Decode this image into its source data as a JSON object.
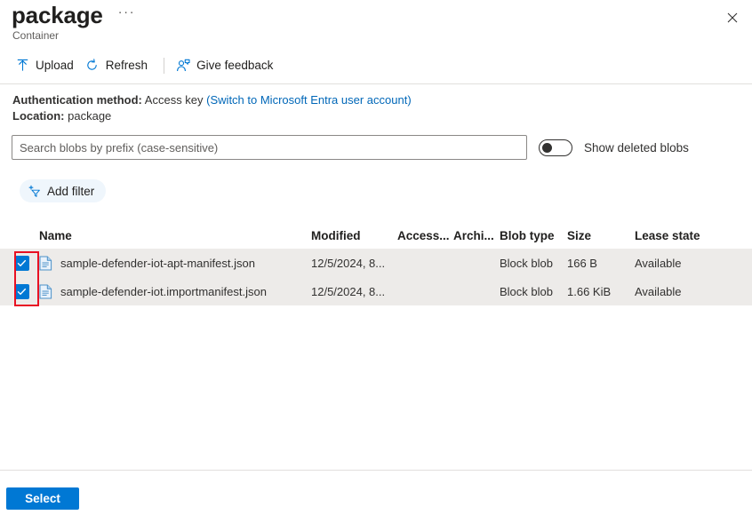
{
  "header": {
    "title": "package",
    "subtitle": "Container",
    "ellipsis": "···",
    "close_icon": "close-icon"
  },
  "commandbar": {
    "items": [
      {
        "label": "Upload",
        "icon": "upload-icon"
      },
      {
        "label": "Refresh",
        "icon": "refresh-icon"
      },
      {
        "label": "Give feedback",
        "icon": "feedback-person-icon"
      }
    ]
  },
  "auth": {
    "method_label": "Authentication method:",
    "method_value": "Access key",
    "switch_link": "(Switch to Microsoft Entra user account)",
    "location_label": "Location:",
    "location_value": "package"
  },
  "search": {
    "placeholder": "Search blobs by prefix (case-sensitive)",
    "value": ""
  },
  "toggle": {
    "label": "Show deleted blobs",
    "checked": false
  },
  "filter": {
    "add_label": "Add filter",
    "icon": "add-filter-funnel-icon"
  },
  "table": {
    "columns": [
      "Name",
      "Modified",
      "Access...",
      "Archi...",
      "Blob type",
      "Size",
      "Lease state"
    ],
    "rows": [
      {
        "selected": true,
        "icon": "json-file-icon",
        "name": "sample-defender-iot-apt-manifest.json",
        "modified": "12/5/2024, 8...",
        "access_tier": "",
        "archive_status": "",
        "blob_type": "Block blob",
        "size": "166 B",
        "lease_state": "Available"
      },
      {
        "selected": true,
        "icon": "json-file-icon",
        "name": "sample-defender-iot.importmanifest.json",
        "modified": "12/5/2024, 8...",
        "access_tier": "",
        "archive_status": "",
        "blob_type": "Block blob",
        "size": "1.66 KiB",
        "lease_state": "Available"
      }
    ]
  },
  "footer": {
    "select_label": "Select"
  },
  "colors": {
    "accent": "#0078d4",
    "link": "#0067b8",
    "annotation": "#e81123",
    "row_selected_bg": "#edebe9"
  }
}
